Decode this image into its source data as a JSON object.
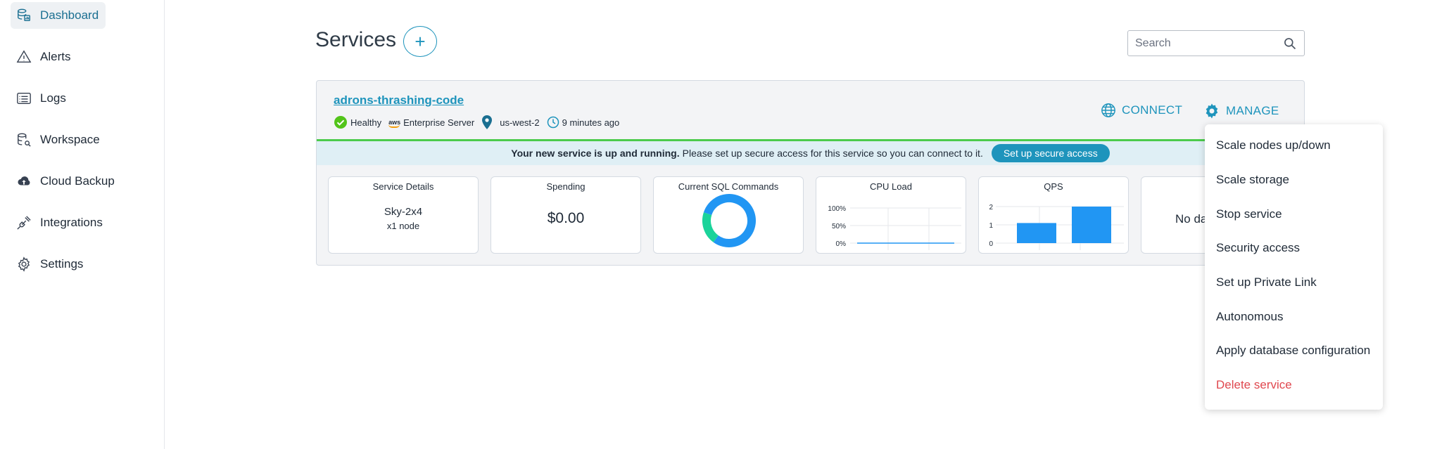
{
  "sidebar": {
    "items": [
      {
        "label": "Dashboard",
        "icon": "dashboard-icon"
      },
      {
        "label": "Alerts",
        "icon": "alert-triangle-icon"
      },
      {
        "label": "Logs",
        "icon": "logs-icon"
      },
      {
        "label": "Workspace",
        "icon": "workspace-icon"
      },
      {
        "label": "Cloud Backup",
        "icon": "cloud-upload-icon"
      },
      {
        "label": "Integrations",
        "icon": "plug-icon"
      },
      {
        "label": "Settings",
        "icon": "gear-icon"
      }
    ]
  },
  "header": {
    "title": "Services",
    "add_label": "+",
    "search_placeholder": "Search"
  },
  "service": {
    "name": "adrons-thrashing-code",
    "status": "Healthy",
    "provider_logo": "aws",
    "tier": "Enterprise Server",
    "region": "us-west-2",
    "created": "9 minutes ago",
    "connect_label": "CONNECT",
    "manage_label": "MANAGE",
    "status_color": "#52c41a",
    "accent_color": "#1e94bc"
  },
  "banner": {
    "bold": "Your new service is up and running.",
    "text": "Please set up secure access for this service so you can connect to it.",
    "button": "Set up secure access"
  },
  "tiles": {
    "details": {
      "title": "Service Details",
      "size": "Sky-2x4",
      "nodes": "x1 node"
    },
    "spending": {
      "title": "Spending",
      "value": "$0.00"
    },
    "sql": {
      "title": "Current SQL Commands"
    },
    "cpu": {
      "title": "CPU Load"
    },
    "qps": {
      "title": "QPS"
    },
    "extra": {
      "text": "No da"
    }
  },
  "chart_data": [
    {
      "type": "pie",
      "title": "Current SQL Commands",
      "values": [
        80,
        20
      ],
      "colors": [
        "#2196f3",
        "#1bd39a"
      ]
    },
    {
      "type": "line",
      "title": "CPU Load",
      "yticks": [
        "100%",
        "50%",
        "0%"
      ],
      "ylim": [
        0,
        100
      ],
      "x": [
        0,
        1,
        2
      ],
      "values": [
        0,
        0,
        0
      ]
    },
    {
      "type": "bar",
      "title": "QPS",
      "yticks": [
        "2",
        "1",
        "0"
      ],
      "ylim": [
        0,
        2
      ],
      "values": [
        1.1,
        2.0
      ]
    }
  ],
  "manage_menu": {
    "items": [
      "Scale nodes up/down",
      "Scale storage",
      "Stop service",
      "Security access",
      "Set up Private Link",
      "Autonomous",
      "Apply database configuration"
    ],
    "danger": "Delete service"
  }
}
